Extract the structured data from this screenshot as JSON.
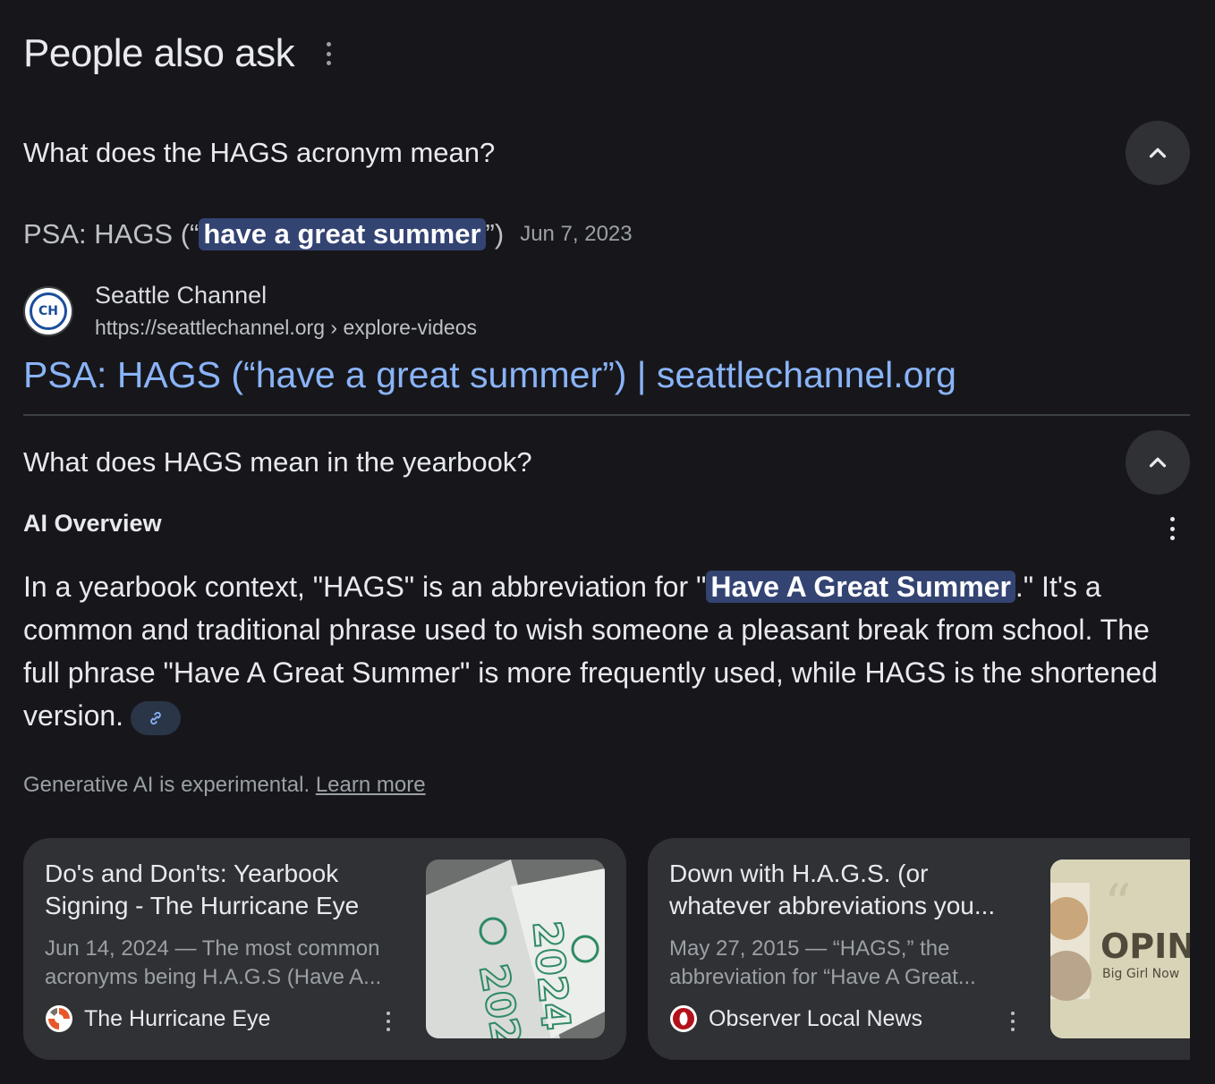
{
  "header": {
    "title": "People also ask"
  },
  "questions": [
    {
      "text": "What does the HAGS acronym mean?"
    },
    {
      "text": "What does HAGS mean in the yearbook?"
    }
  ],
  "answer1": {
    "title_pre": "PSA: HAGS (“",
    "title_highlight": "have a great summer",
    "title_post": "”)",
    "date": "Jun 7, 2023",
    "source_name": "Seattle Channel",
    "source_url": "https://seattlechannel.org › explore-videos",
    "link_text": "PSA: HAGS (“have a great summer”) | seattlechannel.org"
  },
  "ai_overview": {
    "label": "AI Overview",
    "text_pre": "In a yearbook context, \"HAGS\" is an abbreviation for \"",
    "text_highlight": "Have A Great Summer",
    "text_post": ".\" It's a common and traditional phrase used to wish someone a pleasant break from school. The full phrase \"Have A Great Summer\" is more frequently used, while HAGS is the shortened version.",
    "disclaimer": "Generative AI is experimental.",
    "learn_more": "Learn more"
  },
  "cards": [
    {
      "title": "Do's and Don'ts: Yearbook Signing - The Hurricane Eye",
      "snippet": "Jun 14, 2024 — The most common acronyms being H.A.G.S (Have A...",
      "source": "The Hurricane Eye"
    },
    {
      "title": "Down with H.A.G.S. (or whatever abbreviations you...",
      "snippet": "May 27, 2015 — “HAGS,” the abbreviation for “Have A Great...",
      "source": "Observer Local News"
    }
  ],
  "thumbs": {
    "hurricane_text": "2024",
    "observer_text": "OPINIO",
    "observer_sub": "Big Girl Now"
  },
  "colors": {
    "link": "#8ab4f8",
    "highlight": "#334372",
    "background": "#17171b"
  }
}
